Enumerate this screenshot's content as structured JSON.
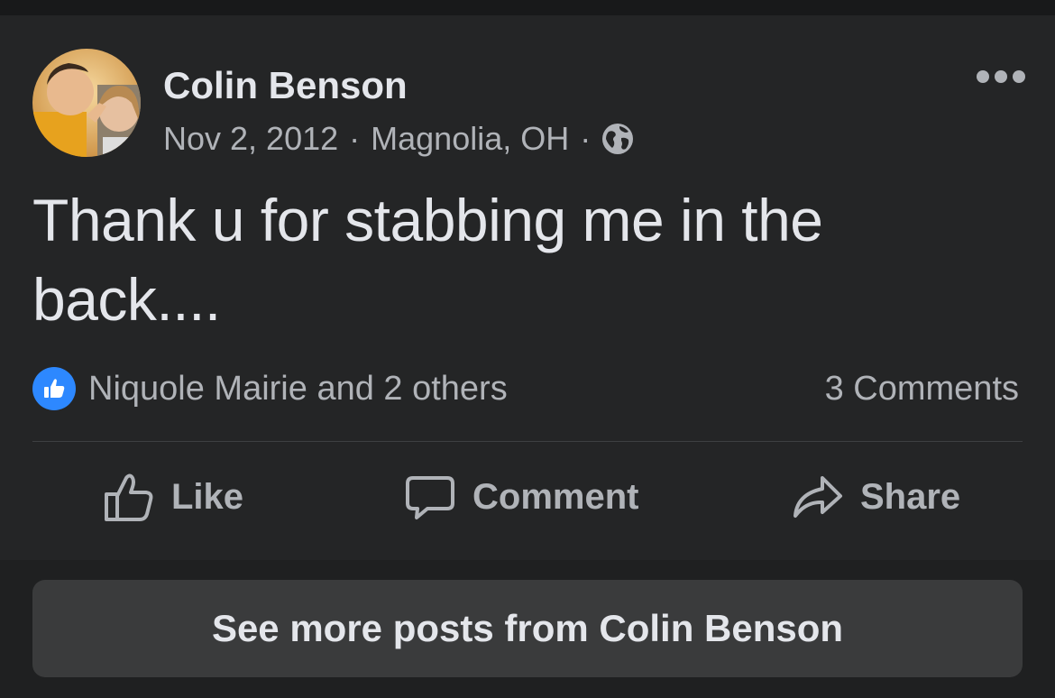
{
  "post": {
    "author": "Colin Benson",
    "date": "Nov 2, 2012",
    "location": "Magnolia, OH",
    "separator": "·",
    "privacy_icon": "globe-icon",
    "text": "Thank u for stabbing me in the back...."
  },
  "engagement": {
    "reaction_icon": "like-icon",
    "reactions_text": "Niquole Mairie and 2 others",
    "comments_text": "3 Comments"
  },
  "actions": {
    "like_label": "Like",
    "comment_label": "Comment",
    "share_label": "Share"
  },
  "footer": {
    "see_more_label": "See more posts from Colin Benson"
  },
  "colors": {
    "background": "#242526",
    "text_primary": "#e4e6eb",
    "text_secondary": "#b0b3b8",
    "like_blue": "#2d88ff",
    "button_bg": "#3a3b3c"
  }
}
